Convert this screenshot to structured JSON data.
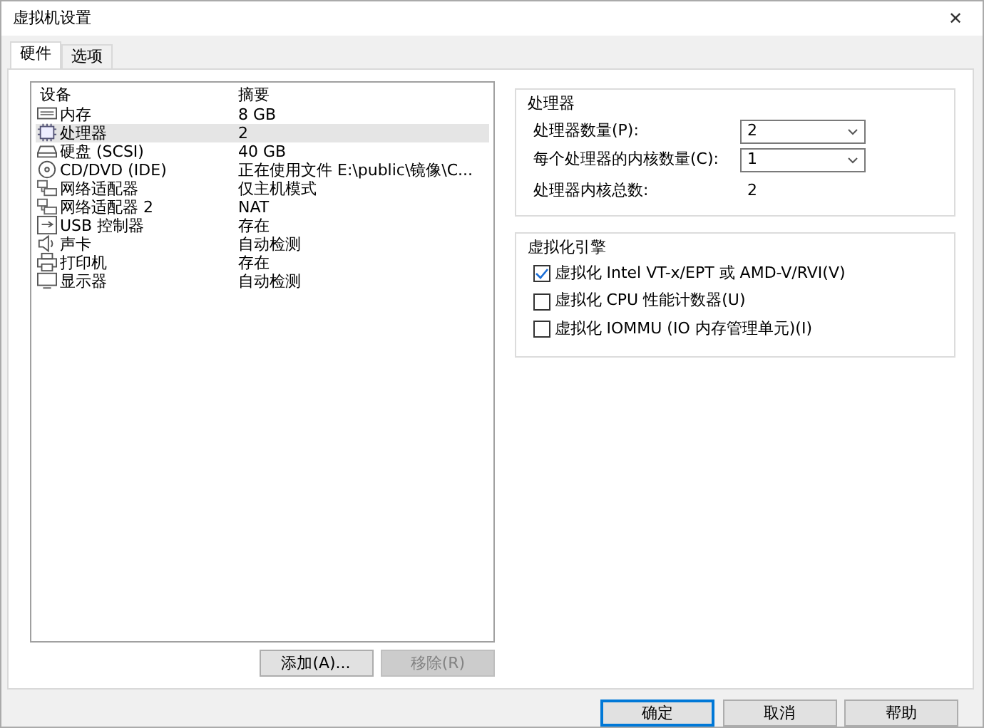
{
  "window": {
    "title": "虚拟机设置",
    "close": "✕"
  },
  "tabs": [
    {
      "label": "硬件",
      "selected": true
    },
    {
      "label": "选项",
      "selected": false
    }
  ],
  "devices": {
    "columns": [
      "设备",
      "摘要"
    ],
    "rows": [
      {
        "kind": "memory",
        "device": "内存",
        "summary": "8 GB",
        "selected": false
      },
      {
        "kind": "cpu",
        "device": "处理器",
        "summary": "2",
        "selected": true
      },
      {
        "kind": "disk",
        "device": "硬盘 (SCSI)",
        "summary": "40 GB",
        "selected": false
      },
      {
        "kind": "cd",
        "device": "CD/DVD (IDE)",
        "summary": "正在使用文件 E:\\public\\镜像\\C...",
        "selected": false
      },
      {
        "kind": "network",
        "device": "网络适配器",
        "summary": "仅主机模式",
        "selected": false
      },
      {
        "kind": "network",
        "device": "网络适配器 2",
        "summary": "NAT",
        "selected": false
      },
      {
        "kind": "usb",
        "device": "USB 控制器",
        "summary": "存在",
        "selected": false
      },
      {
        "kind": "sound",
        "device": "声卡",
        "summary": "自动检测",
        "selected": false
      },
      {
        "kind": "printer",
        "device": "打印机",
        "summary": "存在",
        "selected": false
      },
      {
        "kind": "display",
        "device": "显示器",
        "summary": "自动检测",
        "selected": false
      }
    ],
    "buttons": [
      {
        "label": "添加(A)...",
        "disabled": false
      },
      {
        "label": "移除(R)",
        "disabled": true
      }
    ]
  },
  "processor": {
    "title": "处理器",
    "fields": [
      {
        "label": "处理器数量(P):",
        "value": "2"
      },
      {
        "label": "每个处理器的内核数量(C):",
        "value": "1"
      }
    ],
    "total_label": "处理器内核总数:",
    "total_value": "2"
  },
  "virtualization": {
    "title": "虚拟化引擎",
    "options": [
      {
        "label": "虚拟化 Intel VT-x/EPT 或 AMD-V/RVI(V)",
        "checked": true
      },
      {
        "label": "虚拟化 CPU 性能计数器(U)",
        "checked": false
      },
      {
        "label": "虚拟化 IOMMU (IO 内存管理单元)(I)",
        "checked": false
      }
    ]
  },
  "footer_buttons": [
    {
      "label": "确定",
      "default": true
    },
    {
      "label": "取消",
      "default": false
    },
    {
      "label": "帮助",
      "default": false
    }
  ]
}
